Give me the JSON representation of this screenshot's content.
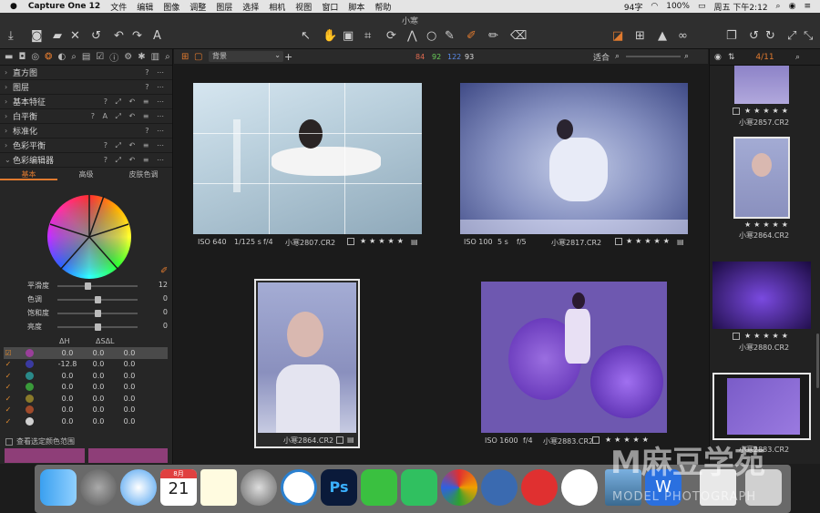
{
  "menubar": {
    "app_name": "Capture One 12",
    "items": [
      "文件",
      "编辑",
      "图像",
      "调整",
      "图层",
      "选择",
      "相机",
      "视图",
      "窗口",
      "脚本",
      "帮助"
    ],
    "status_text": "94字",
    "battery": "100%",
    "clock": "周五 下午2:12"
  },
  "window": {
    "title": "小寒"
  },
  "left_panel": {
    "tools": [
      "直方图",
      "图层",
      "基本特征",
      "白平衡",
      "标准化",
      "色彩平衡",
      "色彩编辑器"
    ],
    "editor_tabs": [
      "基本",
      "高级",
      "皮肤色调"
    ],
    "sliders": [
      {
        "label": "平滑度",
        "value": "12",
        "pos": 0.38
      },
      {
        "label": "色调",
        "value": "0",
        "pos": 0.5
      },
      {
        "label": "饱和度",
        "value": "0",
        "pos": 0.5
      },
      {
        "label": "亮度",
        "value": "0",
        "pos": 0.5
      }
    ],
    "table_headers": [
      "ΔH",
      "ΔS",
      "ΔL"
    ],
    "rows": [
      {
        "color": "#9a3f9a",
        "h": "0.0",
        "s": "0.0",
        "l": "0.0",
        "selected": true
      },
      {
        "color": "#3a3aa0",
        "h": "-12.8",
        "s": "0.0",
        "l": "0.0",
        "selected": false
      },
      {
        "color": "#2a8a8a",
        "h": "0.0",
        "s": "0.0",
        "l": "0.0",
        "selected": false
      },
      {
        "color": "#3a9a3a",
        "h": "0.0",
        "s": "0.0",
        "l": "0.0",
        "selected": false
      },
      {
        "color": "#8a7a2a",
        "h": "0.0",
        "s": "0.0",
        "l": "0.0",
        "selected": false
      },
      {
        "color": "#a04a2a",
        "h": "0.0",
        "s": "0.0",
        "l": "0.0",
        "selected": false
      },
      {
        "color": "#d0d0d0",
        "h": "0.0",
        "s": "0.0",
        "l": "0.0",
        "selected": false
      }
    ],
    "show_range_label": "查看选定颜色范围"
  },
  "viewer": {
    "style_name": "背景",
    "counts": [
      {
        "v": "84",
        "c": "#e06a50"
      },
      {
        "v": "92",
        "c": "#6ad05a"
      },
      {
        "v": "122",
        "c": "#5a8ae8"
      },
      {
        "v": "93",
        "c": "#dddddd"
      }
    ],
    "fit_label": "适合",
    "thumbs": [
      {
        "iso": "ISO 640",
        "shutter": "1/125 s",
        "aperture": "f/4",
        "name": "小寒2807.CR2"
      },
      {
        "iso": "ISO 100",
        "shutter": "5 s",
        "aperture": "f/5",
        "name": "小寒2817.CR2"
      },
      {
        "iso": "",
        "shutter": "",
        "aperture": "",
        "name": "小寒2864.CR2"
      },
      {
        "iso": "ISO 1600",
        "shutter": "",
        "aperture": "f/4",
        "name": "小寒2883.CR2"
      }
    ],
    "stars": "★★★★★"
  },
  "right_panel": {
    "counter": "4/11",
    "items": [
      "小寒2857.CR2",
      "小寒2864.CR2",
      "小寒2880.CR2",
      "小寒2883.CR2"
    ]
  },
  "dock": {
    "calendar_month": "8月",
    "calendar_day": "21"
  },
  "watermark": {
    "big": "M麻豆学苑",
    "small": "MODEL PHOTOGRAPH"
  }
}
